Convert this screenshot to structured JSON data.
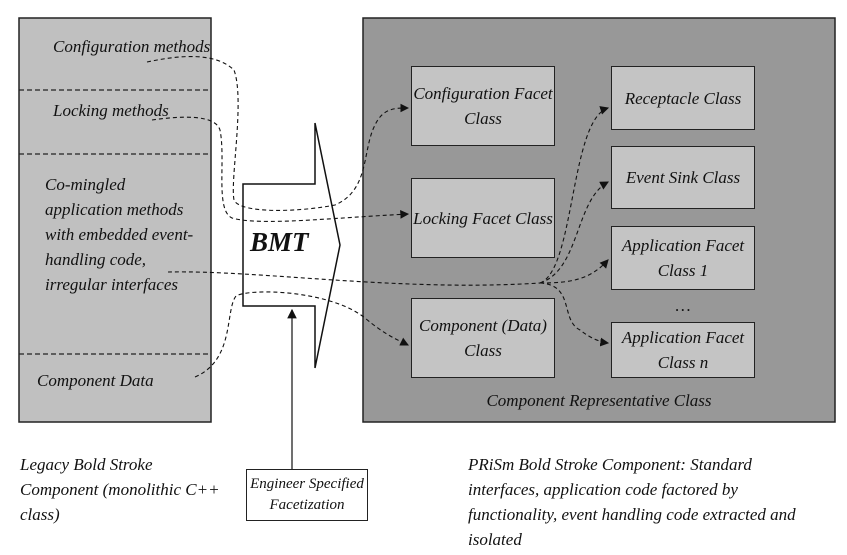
{
  "legacy": {
    "sections": [
      "Configuration methods",
      "Locking methods",
      "Co-mingled application methods with embedded event-handling code, irregular interfaces",
      "Component Data"
    ],
    "caption": "Legacy Bold Stroke Component (monolithic C++ class)"
  },
  "bmt": {
    "label": "BMT"
  },
  "engineer": {
    "label": "Engineer Specified Facetization"
  },
  "prism": {
    "container_label": "Component Representative Class",
    "boxes": [
      "Configuration Facet Class",
      "Locking Facet Class",
      "Component (Data) Class",
      "Receptacle Class",
      "Event Sink Class",
      "Application Facet Class 1",
      "Application Facet Class n"
    ],
    "ellipsis": "…",
    "caption": "PRiSm Bold Stroke Component: Standard interfaces, application code factored by functionality, event handling code extracted and isolated"
  },
  "colors": {
    "legacy_fill": "#c0c0c0",
    "container_fill": "#989898",
    "box_fill": "#c4c4c4"
  }
}
